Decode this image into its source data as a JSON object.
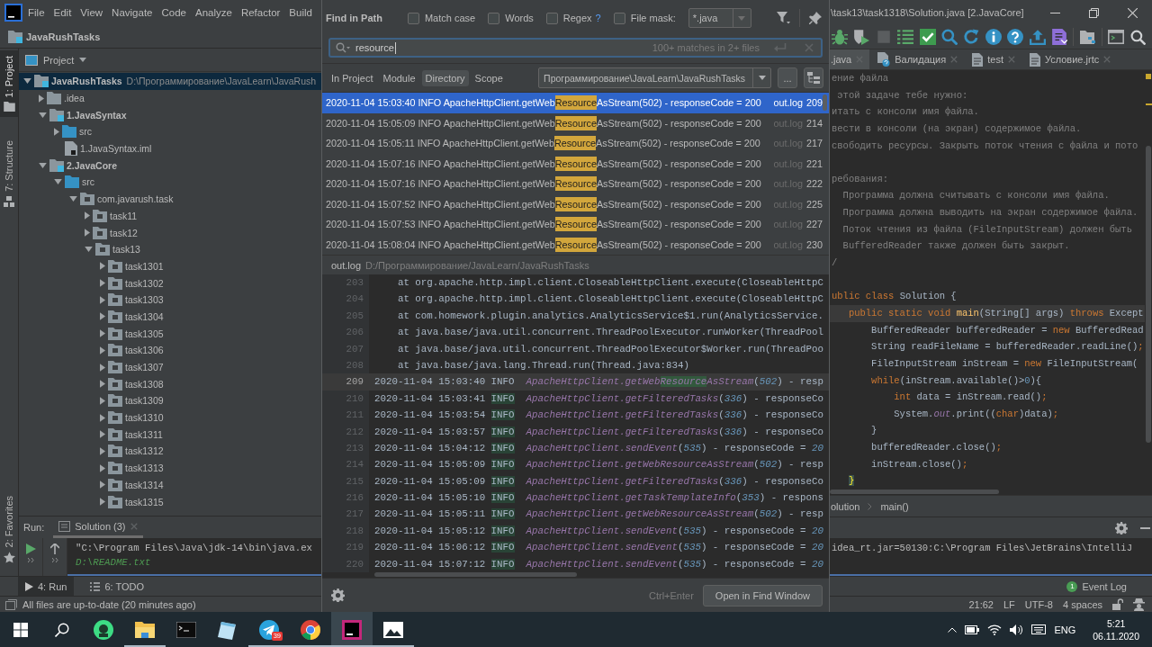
{
  "menu_bar": {
    "items": [
      "File",
      "Edit",
      "View",
      "Navigate",
      "Code",
      "Analyze",
      "Refactor",
      "Build"
    ]
  },
  "navigation_bar": {
    "project": "JavaRushTasks"
  },
  "tool_strip": {
    "top": [
      {
        "label": "1: Project",
        "kind": "project",
        "selected": true
      },
      {
        "label": "7: Structure",
        "kind": "structure",
        "selected": false
      }
    ],
    "bottom": [
      {
        "label": "2: Favorites",
        "kind": "favorites",
        "selected": false
      }
    ]
  },
  "project_panel": {
    "title": "Project",
    "tree": [
      {
        "name": "JavaRushTasks",
        "path": "D:\\Программирование\\JavaLearn\\JavaRush",
        "kind": "module",
        "expanded": true,
        "selected": true,
        "children": [
          {
            "name": ".idea",
            "kind": "folder",
            "expanded": false,
            "selected": false
          },
          {
            "name": "1.JavaSyntax",
            "kind": "module",
            "expanded": true,
            "selected": false,
            "children": [
              {
                "name": "src",
                "kind": "source",
                "expanded": false,
                "selected": false
              },
              {
                "name": "1.JavaSyntax.iml",
                "kind": "file",
                "selected": false
              }
            ]
          },
          {
            "name": "2.JavaCore",
            "kind": "module",
            "expanded": true,
            "selected": false,
            "children": [
              {
                "name": "src",
                "kind": "source",
                "expanded": true,
                "selected": false,
                "children": [
                  {
                    "name": "com.javarush.task",
                    "kind": "package",
                    "expanded": true,
                    "selected": false,
                    "children": [
                      {
                        "name": "task11",
                        "kind": "package",
                        "expanded": false,
                        "selected": false
                      },
                      {
                        "name": "task12",
                        "kind": "package",
                        "expanded": false,
                        "selected": false
                      },
                      {
                        "name": "task13",
                        "kind": "package",
                        "expanded": true,
                        "selected": false,
                        "children": [
                          {
                            "name": "task1301",
                            "kind": "package",
                            "expanded": false,
                            "selected": false
                          },
                          {
                            "name": "task1302",
                            "kind": "package",
                            "expanded": false,
                            "selected": false
                          },
                          {
                            "name": "task1303",
                            "kind": "package",
                            "expanded": false,
                            "selected": false
                          },
                          {
                            "name": "task1304",
                            "kind": "package",
                            "expanded": false,
                            "selected": false
                          },
                          {
                            "name": "task1305",
                            "kind": "package",
                            "expanded": false,
                            "selected": false
                          },
                          {
                            "name": "task1306",
                            "kind": "package",
                            "expanded": false,
                            "selected": false
                          },
                          {
                            "name": "task1307",
                            "kind": "package",
                            "expanded": false,
                            "selected": false
                          },
                          {
                            "name": "task1308",
                            "kind": "package",
                            "expanded": false,
                            "selected": false
                          },
                          {
                            "name": "task1309",
                            "kind": "package",
                            "expanded": false,
                            "selected": false
                          },
                          {
                            "name": "task1310",
                            "kind": "package",
                            "expanded": false,
                            "selected": false
                          },
                          {
                            "name": "task1311",
                            "kind": "package",
                            "expanded": false,
                            "selected": false
                          },
                          {
                            "name": "task1312",
                            "kind": "package",
                            "expanded": false,
                            "selected": false
                          },
                          {
                            "name": "task1313",
                            "kind": "package",
                            "expanded": false,
                            "selected": false
                          },
                          {
                            "name": "task1314",
                            "kind": "package",
                            "expanded": false,
                            "selected": false
                          },
                          {
                            "name": "task1315",
                            "kind": "package",
                            "expanded": false,
                            "selected": false
                          }
                        ]
                      }
                    ]
                  }
                ]
              }
            ]
          }
        ]
      }
    ]
  },
  "run_panel": {
    "title": "Run:",
    "tabs": [
      {
        "label": "Solution (3)",
        "selected": true
      }
    ],
    "console": [
      {
        "text": "\"C:\\Program Files\\Java\\jdk-14\\bin\\java.ex",
        "kind": "command"
      },
      {
        "text": "D:\\README.txt",
        "kind": "input"
      }
    ],
    "console_continued": [
      "idea_rt.jar=50130:C:\\Program Files\\JetBrains\\IntelliJ"
    ]
  },
  "tool_window_bar": {
    "tabs": [
      {
        "label": "4: Run",
        "kind": "run",
        "selected": true
      },
      {
        "label": "6: TODO",
        "kind": "todo",
        "selected": false
      }
    ],
    "event_log": {
      "label": "Event Log",
      "count": "1"
    }
  },
  "status_bar": {
    "message": "All files are up-to-date (20 minutes ago)",
    "items": [
      "21:62",
      "LF",
      "UTF-8",
      "4 spaces"
    ]
  },
  "find_dialog": {
    "title": "Find in Path",
    "options": [
      {
        "label": "Match case",
        "checked": false
      },
      {
        "label": "Words",
        "checked": false
      },
      {
        "label": "Regex",
        "checked": false,
        "help": "?"
      }
    ],
    "file_mask": {
      "label": "File mask:",
      "checked": false,
      "value": "*.java"
    },
    "search": {
      "value": "resource",
      "summary": "100+ matches in 2+ files"
    },
    "scopes": [
      {
        "label": "In Project",
        "selected": false
      },
      {
        "label": "Module",
        "selected": false
      },
      {
        "label": "Directory",
        "selected": true
      },
      {
        "label": "Scope",
        "selected": false
      }
    ],
    "directory": {
      "value": "Программирование\\JavaLearn\\JavaRushTasks",
      "browse": "..."
    },
    "results": [
      {
        "before": "2020-11-04 15:03:40 INFO ApacheHttpClient.getWeb",
        "match": "Resource",
        "after": "AsStream(502) - responseCode = 200",
        "file": "out.log",
        "line": "209",
        "selected": true
      },
      {
        "before": "2020-11-04 15:05:09 INFO ApacheHttpClient.getWeb",
        "match": "Resource",
        "after": "AsStream(502) - responseCode = 200",
        "file": "out.log",
        "line": "214",
        "selected": false
      },
      {
        "before": "2020-11-04 15:05:11 INFO ApacheHttpClient.getWeb",
        "match": "Resource",
        "after": "AsStream(502) - responseCode = 200",
        "file": "out.log",
        "line": "217",
        "selected": false
      },
      {
        "before": "2020-11-04 15:07:16 INFO ApacheHttpClient.getWeb",
        "match": "Resource",
        "after": "AsStream(502) - responseCode = 200",
        "file": "out.log",
        "line": "221",
        "selected": false
      },
      {
        "before": "2020-11-04 15:07:16 INFO ApacheHttpClient.getWeb",
        "match": "Resource",
        "after": "AsStream(502) - responseCode = 200",
        "file": "out.log",
        "line": "222",
        "selected": false
      },
      {
        "before": "2020-11-04 15:07:52 INFO ApacheHttpClient.getWeb",
        "match": "Resource",
        "after": "AsStream(502) - responseCode = 200",
        "file": "out.log",
        "line": "225",
        "selected": false
      },
      {
        "before": "2020-11-04 15:07:53 INFO ApacheHttpClient.getWeb",
        "match": "Resource",
        "after": "AsStream(502) - responseCode = 200",
        "file": "out.log",
        "line": "227",
        "selected": false
      },
      {
        "before": "2020-11-04 15:08:04 INFO ApacheHttpClient.getWeb",
        "match": "Resource",
        "after": "AsStream(502) - responseCode = 200",
        "file": "out.log",
        "line": "230",
        "selected": false
      }
    ],
    "preview": {
      "file": "out.log",
      "path": "D:/Программирование/JavaLearn/JavaRushTasks",
      "lines": [
        {
          "number": "203",
          "current": false,
          "tokens": [
            {
              "text": "    at org.apache.http.impl.client.CloseableHttpClient.execute(CloseableHttpC",
              "kind": "plain"
            }
          ]
        },
        {
          "number": "204",
          "current": false,
          "tokens": [
            {
              "text": "    at org.apache.http.impl.client.CloseableHttpClient.execute(CloseableHttpC",
              "kind": "plain"
            }
          ]
        },
        {
          "number": "205",
          "current": false,
          "tokens": [
            {
              "text": "    at com.homework.plugin.analytics.AnalyticsService$1.run(AnalyticsService.",
              "kind": "plain"
            }
          ]
        },
        {
          "number": "206",
          "current": false,
          "tokens": [
            {
              "text": "    at java.base/java.util.concurrent.ThreadPoolExecutor.runWorker(ThreadPool",
              "kind": "plain"
            }
          ]
        },
        {
          "number": "207",
          "current": false,
          "tokens": [
            {
              "text": "    at java.base/java.util.concurrent.ThreadPoolExecutor$Worker.run(ThreadPoo",
              "kind": "plain"
            }
          ]
        },
        {
          "number": "208",
          "current": false,
          "tokens": [
            {
              "text": "    at java.base/java.lang.Thread.run(Thread.java:834)",
              "kind": "plain"
            }
          ]
        },
        {
          "number": "209",
          "current": true,
          "tokens": [
            {
              "text": "2020-11-04 15:03:40 INFO  ",
              "kind": "plain"
            },
            {
              "text": "ApacheHttpClient.getWeb",
              "kind": "method"
            },
            {
              "text": "Resource",
              "kind": "match"
            },
            {
              "text": "AsStream",
              "kind": "method"
            },
            {
              "text": "(",
              "kind": "plain"
            },
            {
              "text": "502",
              "kind": "argument"
            },
            {
              "text": ") - resp",
              "kind": "plain"
            }
          ]
        },
        {
          "number": "210",
          "current": false,
          "tokens": [
            {
              "text": "2020-11-04 15:03:41 ",
              "kind": "plain"
            },
            {
              "text": "INFO",
              "kind": "level"
            },
            {
              "text": "  ApacheHttpClient.getFilteredTasks",
              "kind": "method"
            },
            {
              "text": "(",
              "kind": "plain"
            },
            {
              "text": "336",
              "kind": "argument"
            },
            {
              "text": ") - responseCo",
              "kind": "plain"
            }
          ]
        },
        {
          "number": "211",
          "current": false,
          "tokens": [
            {
              "text": "2020-11-04 15:03:54 ",
              "kind": "plain"
            },
            {
              "text": "INFO",
              "kind": "level"
            },
            {
              "text": "  ApacheHttpClient.getFilteredTasks",
              "kind": "method"
            },
            {
              "text": "(",
              "kind": "plain"
            },
            {
              "text": "336",
              "kind": "argument"
            },
            {
              "text": ") - responseCo",
              "kind": "plain"
            }
          ]
        },
        {
          "number": "212",
          "current": false,
          "tokens": [
            {
              "text": "2020-11-04 15:03:57 ",
              "kind": "plain"
            },
            {
              "text": "INFO",
              "kind": "level"
            },
            {
              "text": "  ApacheHttpClient.getFilteredTasks",
              "kind": "method"
            },
            {
              "text": "(",
              "kind": "plain"
            },
            {
              "text": "336",
              "kind": "argument"
            },
            {
              "text": ") - responseCo",
              "kind": "plain"
            }
          ]
        },
        {
          "number": "213",
          "current": false,
          "tokens": [
            {
              "text": "2020-11-04 15:04:12 ",
              "kind": "plain"
            },
            {
              "text": "INFO",
              "kind": "level"
            },
            {
              "text": "  ApacheHttpClient.sendEvent",
              "kind": "method"
            },
            {
              "text": "(",
              "kind": "plain"
            },
            {
              "text": "535",
              "kind": "argument"
            },
            {
              "text": ") - responseCode = ",
              "kind": "plain"
            },
            {
              "text": "20",
              "kind": "argument"
            }
          ]
        },
        {
          "number": "214",
          "current": false,
          "tokens": [
            {
              "text": "2020-11-04 15:05:09 ",
              "kind": "plain"
            },
            {
              "text": "INFO",
              "kind": "level"
            },
            {
              "text": "  ApacheHttpClient.getWebResourceAsStream",
              "kind": "method"
            },
            {
              "text": "(",
              "kind": "plain"
            },
            {
              "text": "502",
              "kind": "argument"
            },
            {
              "text": ") - resp",
              "kind": "plain"
            }
          ]
        },
        {
          "number": "215",
          "current": false,
          "tokens": [
            {
              "text": "2020-11-04 15:05:09 ",
              "kind": "plain"
            },
            {
              "text": "INFO",
              "kind": "level"
            },
            {
              "text": "  ApacheHttpClient.getFilteredTasks",
              "kind": "method"
            },
            {
              "text": "(",
              "kind": "plain"
            },
            {
              "text": "336",
              "kind": "argument"
            },
            {
              "text": ") - responseCo",
              "kind": "plain"
            }
          ]
        },
        {
          "number": "216",
          "current": false,
          "tokens": [
            {
              "text": "2020-11-04 15:05:10 ",
              "kind": "plain"
            },
            {
              "text": "INFO",
              "kind": "level"
            },
            {
              "text": "  ApacheHttpClient.getTaskTemplateInfo",
              "kind": "method"
            },
            {
              "text": "(",
              "kind": "plain"
            },
            {
              "text": "353",
              "kind": "argument"
            },
            {
              "text": ") - respons",
              "kind": "plain"
            }
          ]
        },
        {
          "number": "217",
          "current": false,
          "tokens": [
            {
              "text": "2020-11-04 15:05:11 ",
              "kind": "plain"
            },
            {
              "text": "INFO",
              "kind": "level"
            },
            {
              "text": "  ApacheHttpClient.getWebResourceAsStream",
              "kind": "method"
            },
            {
              "text": "(",
              "kind": "plain"
            },
            {
              "text": "502",
              "kind": "argument"
            },
            {
              "text": ") - resp",
              "kind": "plain"
            }
          ]
        },
        {
          "number": "218",
          "current": false,
          "tokens": [
            {
              "text": "2020-11-04 15:05:12 ",
              "kind": "plain"
            },
            {
              "text": "INFO",
              "kind": "level"
            },
            {
              "text": "  ApacheHttpClient.sendEvent",
              "kind": "method"
            },
            {
              "text": "(",
              "kind": "plain"
            },
            {
              "text": "535",
              "kind": "argument"
            },
            {
              "text": ") - responseCode = ",
              "kind": "plain"
            },
            {
              "text": "20",
              "kind": "argument"
            }
          ]
        },
        {
          "number": "219",
          "current": false,
          "tokens": [
            {
              "text": "2020-11-04 15:06:12 ",
              "kind": "plain"
            },
            {
              "text": "INFO",
              "kind": "level"
            },
            {
              "text": "  ApacheHttpClient.sendEvent",
              "kind": "method"
            },
            {
              "text": "(",
              "kind": "plain"
            },
            {
              "text": "535",
              "kind": "argument"
            },
            {
              "text": ") - responseCode = ",
              "kind": "plain"
            },
            {
              "text": "20",
              "kind": "argument"
            }
          ]
        },
        {
          "number": "220",
          "current": false,
          "tokens": [
            {
              "text": "2020-11-04 15:07:12 ",
              "kind": "plain"
            },
            {
              "text": "INFO",
              "kind": "level"
            },
            {
              "text": "  ApacheHttpClient.sendEvent",
              "kind": "method"
            },
            {
              "text": "(",
              "kind": "plain"
            },
            {
              "text": "535",
              "kind": "argument"
            },
            {
              "text": ") - responseCode = ",
              "kind": "plain"
            },
            {
              "text": "20",
              "kind": "argument"
            }
          ]
        }
      ]
    },
    "footer": {
      "shortcut": "Ctrl+Enter",
      "button": "Open in Find Window"
    }
  },
  "title_bar": {
    "title": "\\task13\\task1318\\Solution.java [2.JavaCore]"
  },
  "editor": {
    "tabs": [
      {
        "label": ".java",
        "kind": "plain",
        "selected": true
      },
      {
        "label": "Валидация",
        "kind": "validation",
        "selected": false
      },
      {
        "label": "test",
        "kind": "document",
        "selected": false
      },
      {
        "label": "Условие.jrtc",
        "kind": "document",
        "selected": false
      }
    ],
    "blocks": [
      {
        "lines": [
          {
            "current": false,
            "tokens": [
              {
                "text": "ение файла",
                "kind": "comment"
              }
            ]
          },
          {
            "current": false,
            "tokens": [
              {
                "text": " этой задаче тебе нужно:",
                "kind": "comment"
              }
            ]
          },
          {
            "current": false,
            "tokens": [
              {
                "text": "итать с консоли имя файла.",
                "kind": "comment"
              }
            ]
          },
          {
            "current": false,
            "tokens": [
              {
                "text": "вести в консоли (на экран) содержимое файла.",
                "kind": "comment"
              }
            ]
          },
          {
            "current": false,
            "tokens": [
              {
                "text": "свободить ресурсы. Закрыть поток чтения с файла и пото",
                "kind": "comment"
              }
            ]
          }
        ]
      },
      {
        "lines": [
          {
            "current": false,
            "tokens": [
              {
                "text": "ребования:",
                "kind": "comment"
              }
            ]
          },
          {
            "current": false,
            "tokens": [
              {
                "text": "  Программа должна считывать с консоли имя файла.",
                "kind": "comment"
              }
            ]
          },
          {
            "current": false,
            "tokens": [
              {
                "text": "  Программа должна выводить на экран содержимое файла.",
                "kind": "comment"
              }
            ]
          },
          {
            "current": false,
            "tokens": [
              {
                "text": "  Поток чтения из файла (FileInputStream) должен быть",
                "kind": "comment"
              }
            ]
          },
          {
            "current": false,
            "tokens": [
              {
                "text": "  BufferedReader также должен быть закрыт.",
                "kind": "comment"
              }
            ]
          },
          {
            "current": false,
            "tokens": [
              {
                "text": "/",
                "kind": "comment"
              }
            ]
          }
        ]
      },
      {
        "lines": [
          {
            "current": false,
            "tokens": [
              {
                "text": "ublic class ",
                "kind": "keyword"
              },
              {
                "text": "Solution {",
                "kind": "plain"
              }
            ]
          },
          {
            "current": true,
            "tokens": [
              {
                "text": "   public static void ",
                "kind": "keyword"
              },
              {
                "text": "main",
                "kind": "declaration"
              },
              {
                "text": "(String[] args) ",
                "kind": "plain"
              },
              {
                "text": "throws ",
                "kind": "keyword"
              },
              {
                "text": "Except",
                "kind": "plain"
              }
            ]
          },
          {
            "current": false,
            "tokens": [
              {
                "text": "       BufferedReader bufferedReader = ",
                "kind": "plain"
              },
              {
                "text": "new ",
                "kind": "keyword"
              },
              {
                "text": "BufferedRead",
                "kind": "plain"
              }
            ]
          },
          {
            "current": false,
            "tokens": [
              {
                "text": "       String readFileName = bufferedReader.readLine()",
                "kind": "plain"
              },
              {
                "text": ";",
                "kind": "keyword"
              }
            ]
          },
          {
            "current": false,
            "tokens": [
              {
                "text": "       FileInputStream inStream = ",
                "kind": "plain"
              },
              {
                "text": "new ",
                "kind": "keyword"
              },
              {
                "text": "FileInputStream(",
                "kind": "plain"
              }
            ]
          },
          {
            "current": false,
            "tokens": [
              {
                "text": "       while",
                "kind": "keyword"
              },
              {
                "text": "(inStream.available()>",
                "kind": "plain"
              },
              {
                "text": "0",
                "kind": "number"
              },
              {
                "text": "){",
                "kind": "plain"
              }
            ]
          },
          {
            "current": false,
            "tokens": [
              {
                "text": "           int ",
                "kind": "keyword"
              },
              {
                "text": "data = inStream.read()",
                "kind": "plain"
              },
              {
                "text": ";",
                "kind": "keyword"
              }
            ]
          },
          {
            "current": false,
            "tokens": [
              {
                "text": "           System.",
                "kind": "plain"
              },
              {
                "text": "out",
                "kind": "field"
              },
              {
                "text": ".print((",
                "kind": "plain"
              },
              {
                "text": "char",
                "kind": "keyword"
              },
              {
                "text": ")data)",
                "kind": "plain"
              },
              {
                "text": ";",
                "kind": "keyword"
              }
            ]
          },
          {
            "current": false,
            "tokens": [
              {
                "text": "       }",
                "kind": "plain"
              }
            ]
          },
          {
            "current": false,
            "tokens": [
              {
                "text": "       bufferedReader.close()",
                "kind": "plain"
              },
              {
                "text": ";",
                "kind": "keyword"
              }
            ]
          },
          {
            "current": false,
            "tokens": [
              {
                "text": "       inStream.close()",
                "kind": "plain"
              },
              {
                "text": ";",
                "kind": "keyword"
              }
            ]
          },
          {
            "current": false,
            "tokens": [
              {
                "text": "   }",
                "kind": "brace"
              }
            ]
          }
        ]
      }
    ],
    "breadcrumbs": [
      "olution",
      "main()"
    ]
  },
  "taskbar": {
    "apps": [
      {
        "kind": "round",
        "running": false,
        "selected": false
      },
      {
        "kind": "explorer",
        "running": true,
        "selected": false
      },
      {
        "kind": "terminal",
        "running": false,
        "selected": false
      },
      {
        "kind": "notes",
        "running": false,
        "selected": false
      },
      {
        "kind": "messenger",
        "running": true,
        "selected": false,
        "badge": "39"
      },
      {
        "kind": "browser",
        "running": true,
        "selected": false
      },
      {
        "kind": "ide",
        "running": true,
        "selected": true
      },
      {
        "kind": "photos",
        "running": true,
        "selected": false
      }
    ],
    "tray": {
      "language": "ENG",
      "time": "5:21",
      "date": "06.11.2020"
    }
  }
}
